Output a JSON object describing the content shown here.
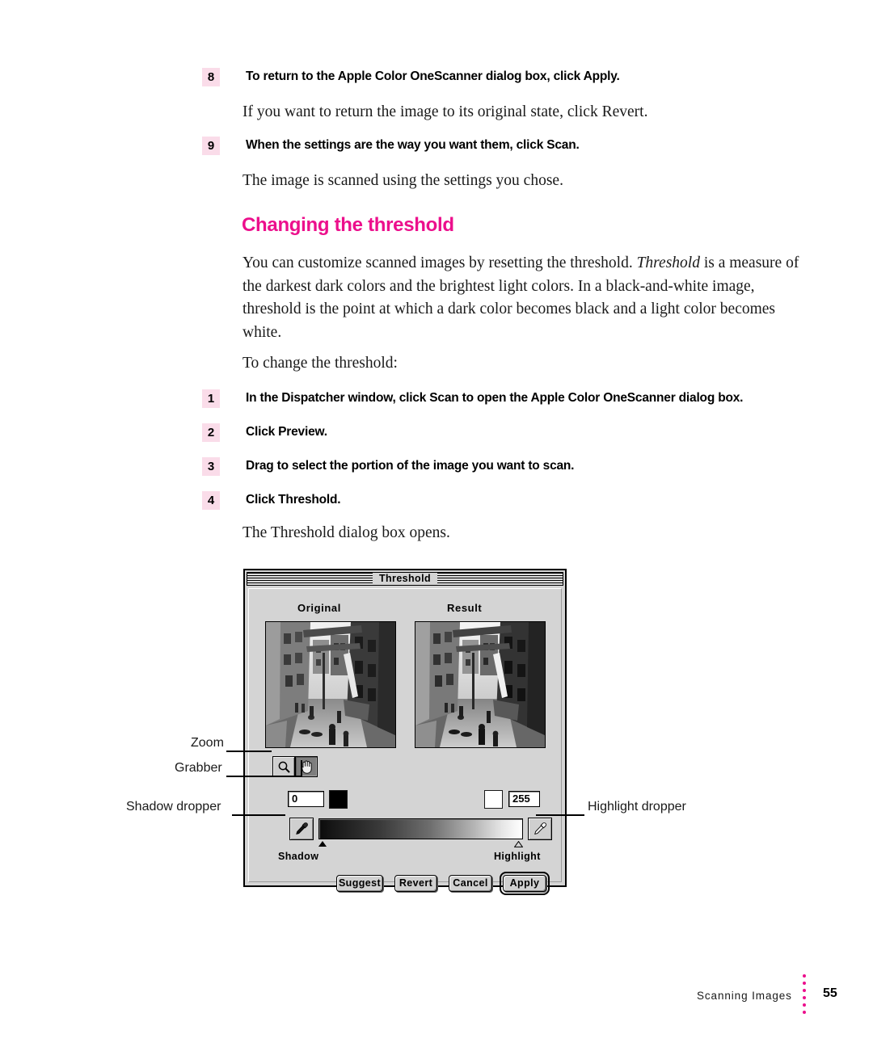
{
  "page": {
    "footer_section": "Scanning Images",
    "footer_page_number": "55",
    "accent_color": "#ec0f8c",
    "step_badge_bg": "#fadce9"
  },
  "top_steps": [
    {
      "number": "8",
      "text": "To return to the Apple Color OneScanner dialog box, click Apply.",
      "note": "If you want to return the image to its original state, click Revert."
    },
    {
      "number": "9",
      "text": "When the settings are the way you want them, click Scan.",
      "note": "The image is scanned using the settings you chose."
    }
  ],
  "section": {
    "heading": "Changing the threshold",
    "paragraph_1_a": "You can customize scanned images by resetting the threshold. ",
    "paragraph_1_em": "Threshold",
    "paragraph_1_b": " is a measure of the darkest dark colors and the brightest light colors. In a black-and-white image, threshold is the point at which a dark color becomes black and a light color becomes white.",
    "lead_in": "To change the threshold:"
  },
  "procedure_steps": [
    {
      "number": "1",
      "text": "In the Dispatcher window, click Scan to open the Apple Color OneScanner dialog box."
    },
    {
      "number": "2",
      "text": "Click Preview."
    },
    {
      "number": "3",
      "text": "Drag to select the portion of the image you want to scan."
    },
    {
      "number": "4",
      "text": "Click Threshold."
    }
  ],
  "after_steps_note": "The Threshold dialog box opens.",
  "dialog": {
    "title": "Threshold",
    "panes": [
      {
        "label": "Original"
      },
      {
        "label": "Result"
      }
    ],
    "tools": [
      {
        "name": "zoom",
        "icon": "magnifier-icon",
        "selected": false
      },
      {
        "name": "grabber",
        "icon": "hand-icon",
        "selected": true
      }
    ],
    "shadow_value": "0",
    "highlight_value": "255",
    "shadow_swatch_color": "#000000",
    "highlight_swatch_color": "#ffffff",
    "ramp_left_label": "Shadow",
    "ramp_right_label": "Highlight",
    "shadow_dropper_icon": "eyedropper-black-icon",
    "highlight_dropper_icon": "eyedropper-white-icon",
    "buttons": [
      {
        "label": "Suggest",
        "default": false
      },
      {
        "label": "Revert",
        "default": false
      },
      {
        "label": "Cancel",
        "default": false
      },
      {
        "label": "Apply",
        "default": true
      }
    ]
  },
  "callouts": [
    {
      "label": "Zoom"
    },
    {
      "label": "Grabber"
    },
    {
      "label": "Shadow dropper"
    },
    {
      "label": "Highlight dropper"
    }
  ]
}
